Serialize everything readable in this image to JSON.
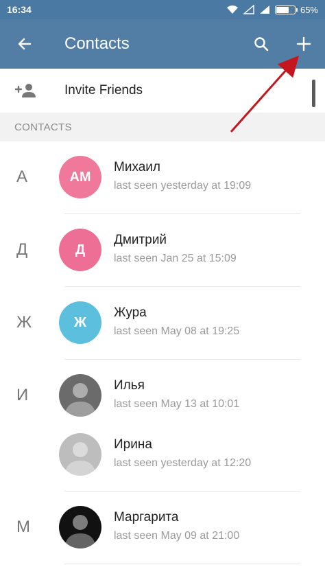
{
  "status_bar": {
    "time": "16:34",
    "battery_text": "65%",
    "battery_level": 0.65
  },
  "toolbar": {
    "title": "Contacts",
    "back_icon": "arrow-left-icon",
    "search_icon": "search-icon",
    "add_icon": "plus-icon"
  },
  "invite": {
    "label": "Invite Friends",
    "icon": "add-person-icon"
  },
  "section": {
    "title": "CONTACTS"
  },
  "contacts": [
    {
      "letter": "А",
      "initials": "AM",
      "avatar_color": "#f0789a",
      "name": "Михаил",
      "status": "last seen yesterday at 19:09"
    },
    {
      "letter": "Д",
      "initials": "Д",
      "avatar_color": "#ee6f96",
      "name": "Дмитрий",
      "status": "last seen Jan 25 at 15:09"
    },
    {
      "letter": "Ж",
      "initials": "Ж",
      "avatar_color": "#5bbfdd",
      "name": "Жура",
      "status": "last seen May 08 at 19:25"
    },
    {
      "letter": "И",
      "initials": "",
      "avatar_color": "#6b6b6b",
      "name": "Илья",
      "status": "last seen May 13 at 10:01"
    },
    {
      "letter": "",
      "initials": "",
      "avatar_color": "#bdbdbd",
      "name": "Ирина",
      "status": "last seen yesterday at 12:20"
    },
    {
      "letter": "М",
      "initials": "",
      "avatar_color": "#111111",
      "name": "Маргарита",
      "status": "last seen May 09 at 21:00"
    }
  ],
  "colors": {
    "toolbar": "#527ea6",
    "status_bar": "#4a7aa3",
    "annotation_arrow": "#c4161c"
  }
}
